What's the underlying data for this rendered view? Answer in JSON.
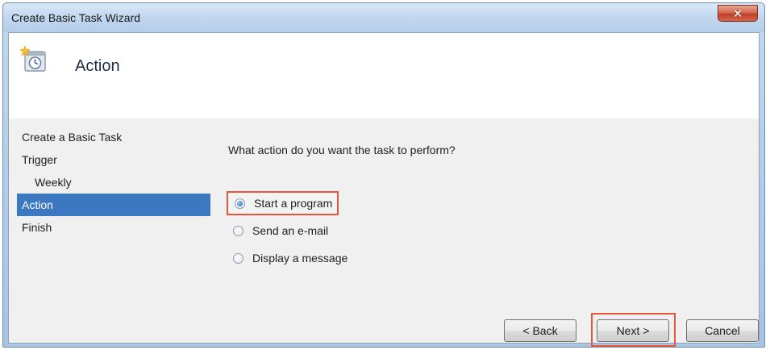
{
  "window": {
    "title": "Create Basic Task Wizard",
    "close_label": "✕"
  },
  "header": {
    "title": "Action",
    "icon": "task-scheduler-icon"
  },
  "nav": {
    "items": [
      {
        "label": "Create a Basic Task",
        "selected": false,
        "indent": false
      },
      {
        "label": "Trigger",
        "selected": false,
        "indent": false
      },
      {
        "label": "Weekly",
        "selected": false,
        "indent": true
      },
      {
        "label": "Action",
        "selected": true,
        "indent": false
      },
      {
        "label": "Finish",
        "selected": false,
        "indent": false
      }
    ]
  },
  "main": {
    "question": "What action do you want the task to perform?",
    "options": [
      {
        "label": "Start a program",
        "checked": true
      },
      {
        "label": "Send an e-mail",
        "checked": false
      },
      {
        "label": "Display a message",
        "checked": false
      }
    ]
  },
  "buttons": {
    "back": "< Back",
    "next": "Next >",
    "cancel": "Cancel"
  },
  "colors": {
    "selected_nav": "#3c78c0",
    "highlight_box": "#e5573a",
    "close_button": "#c1402a"
  }
}
